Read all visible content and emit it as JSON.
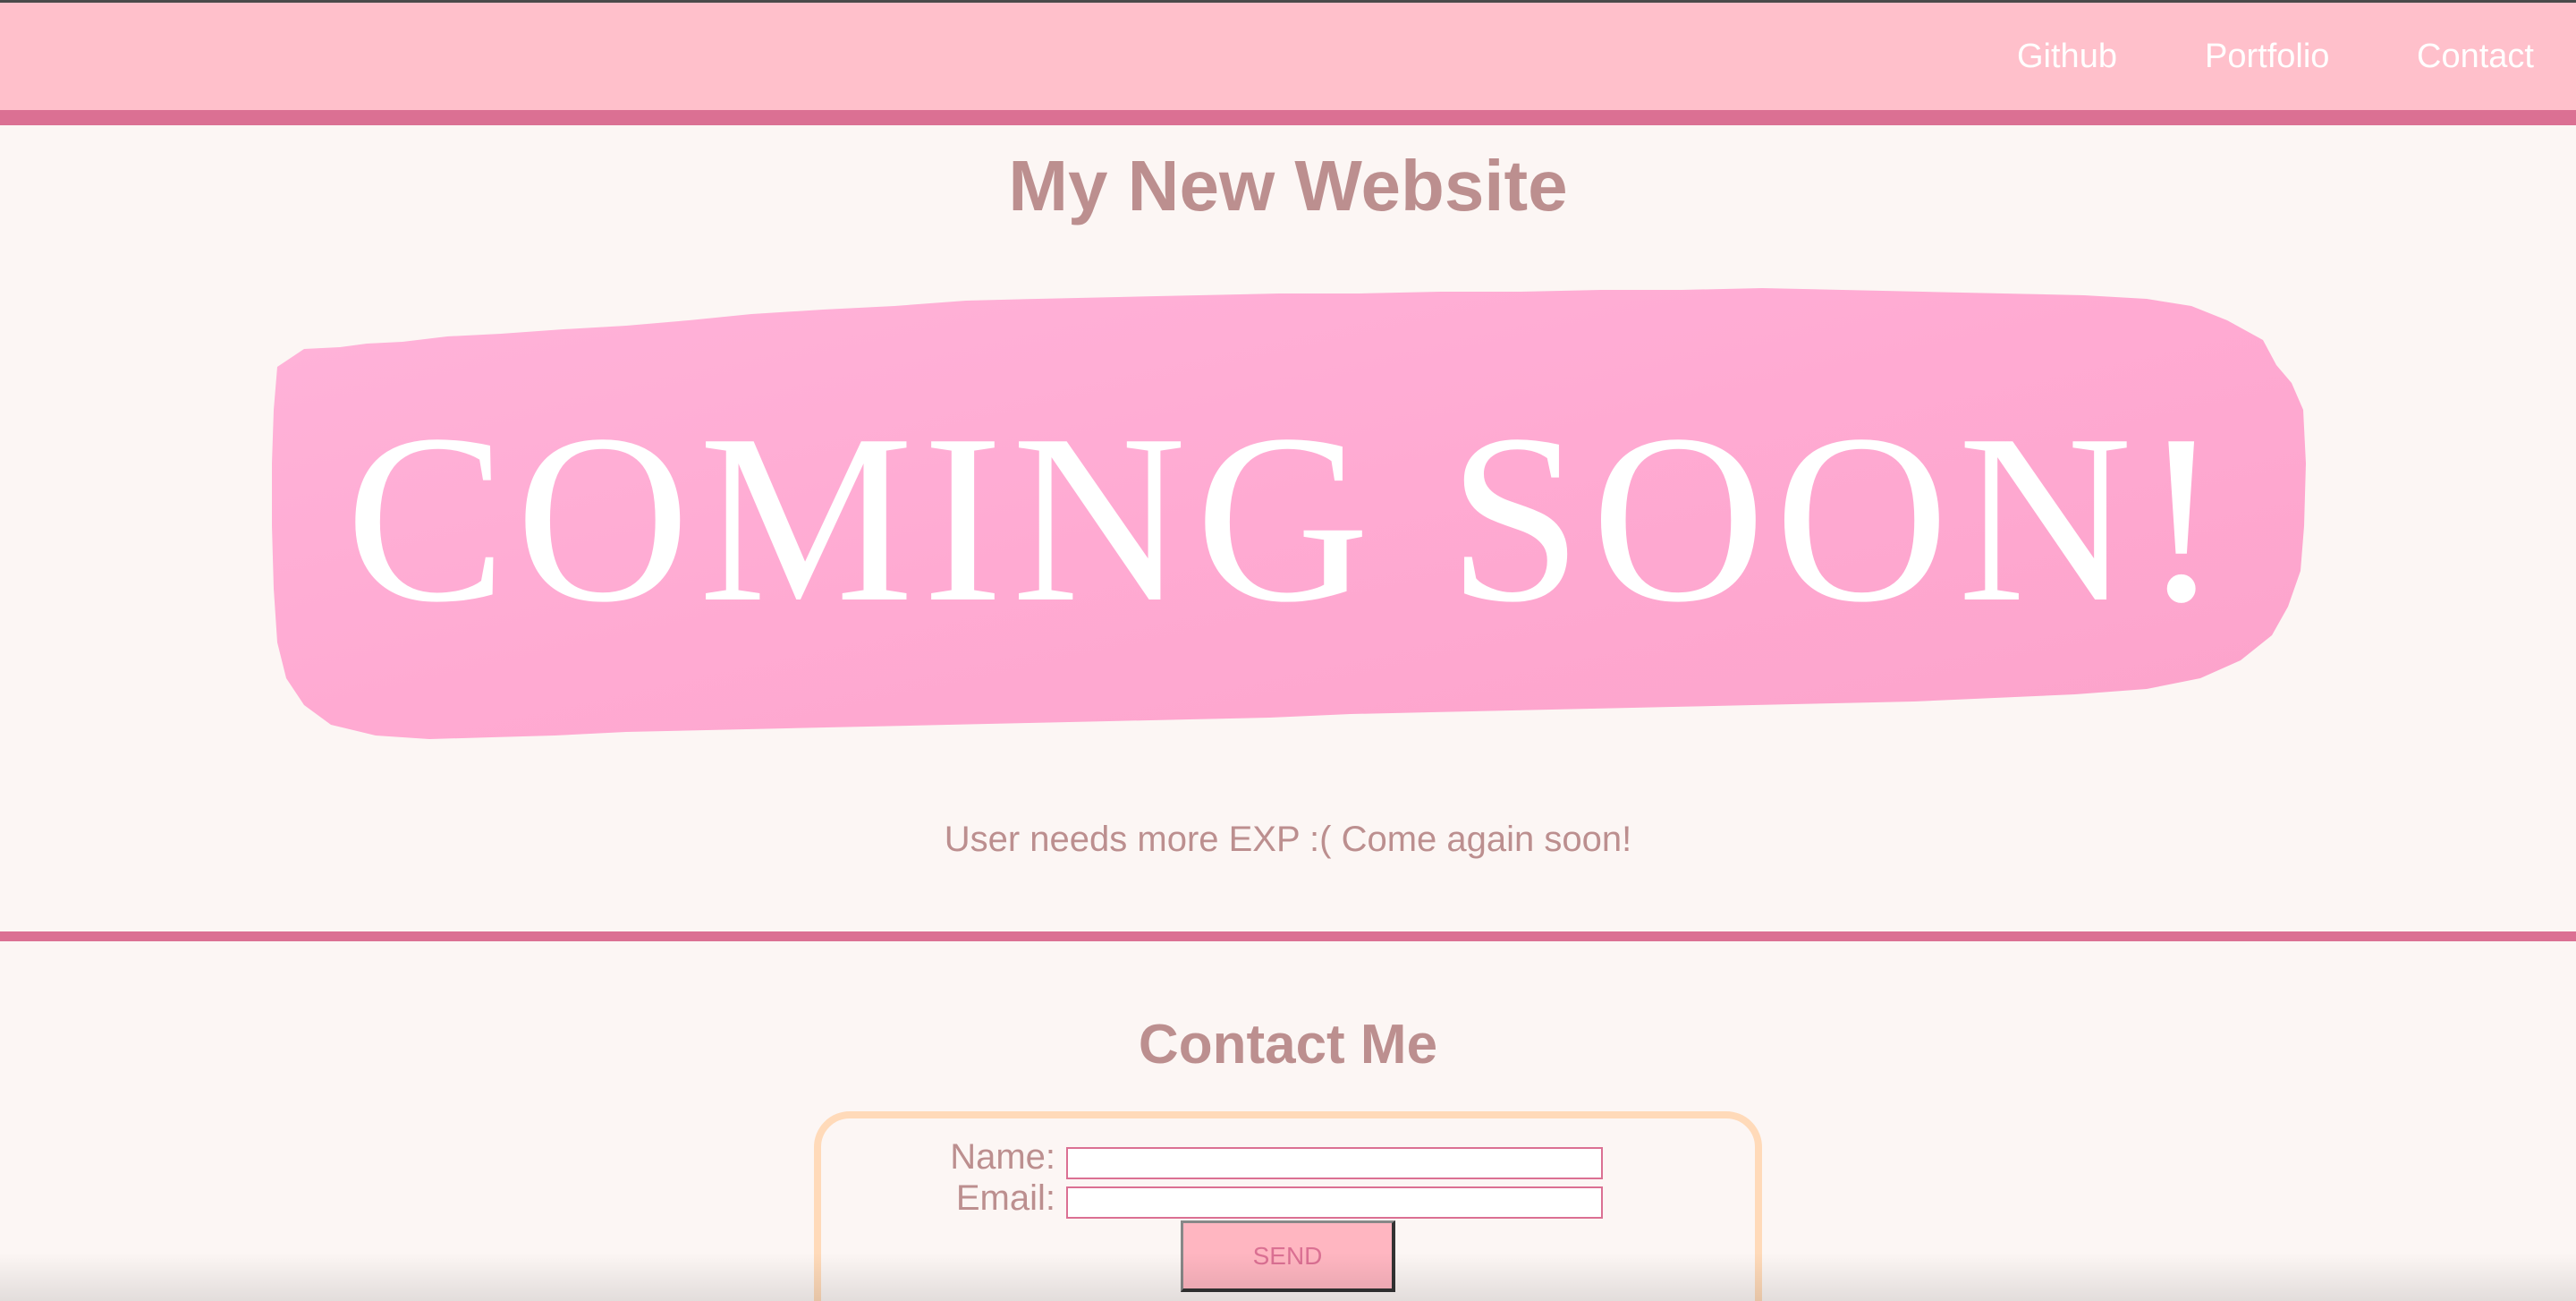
{
  "nav": {
    "links": [
      {
        "label": "Github"
      },
      {
        "label": "Portfolio"
      },
      {
        "label": "Contact"
      }
    ]
  },
  "header": {
    "title": "My New Website"
  },
  "banner": {
    "text": "COMING SOON!",
    "brush_color": "#ffaad2",
    "text_color": "#ffffff"
  },
  "main": {
    "tagline": "User needs more EXP :( Come again soon!"
  },
  "contact": {
    "heading": "Contact Me",
    "name_label": "Name:",
    "name_value": "",
    "email_label": "Email:",
    "email_value": "",
    "send_label": "SEND"
  },
  "colors": {
    "navbar": "#ffc0cb",
    "accent": "#db7093",
    "text": "#bc8f8f",
    "background": "#fcf6f4",
    "form_border": "#ffdab9",
    "button": "#ffb6c1"
  }
}
